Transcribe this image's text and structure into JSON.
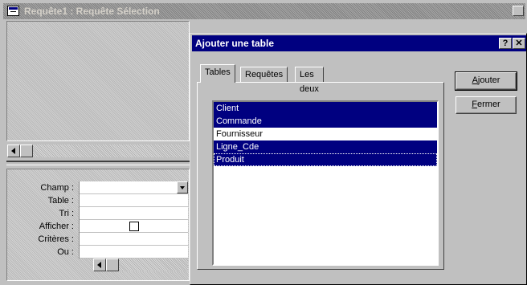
{
  "bg_window": {
    "title": "Requête1 : Requête Sélection"
  },
  "grid": {
    "row_labels": [
      "Champ :",
      "Table :",
      "Tri :",
      "Afficher :",
      "Critères :",
      "Ou :"
    ]
  },
  "dialog": {
    "title": "Ajouter une table",
    "help_label": "?",
    "close_label": "✕",
    "tabs": [
      {
        "label": "Tables",
        "active": true
      },
      {
        "label": "Requêtes",
        "active": false
      },
      {
        "label": "Les deux",
        "active": false
      }
    ],
    "list_items": [
      {
        "label": "Client",
        "selected": true
      },
      {
        "label": "Commande",
        "selected": true
      },
      {
        "label": "Fournisseur",
        "selected": false
      },
      {
        "label": "Ligne_Cde",
        "selected": true
      },
      {
        "label": "Produit",
        "selected": true
      }
    ],
    "add_button": {
      "first": "A",
      "rest": "jouter"
    },
    "close_button": {
      "first": "F",
      "rest": "ermer"
    }
  },
  "colors": {
    "face": "#c0c0c0",
    "title_active": "#000080",
    "selection": "#000080"
  }
}
